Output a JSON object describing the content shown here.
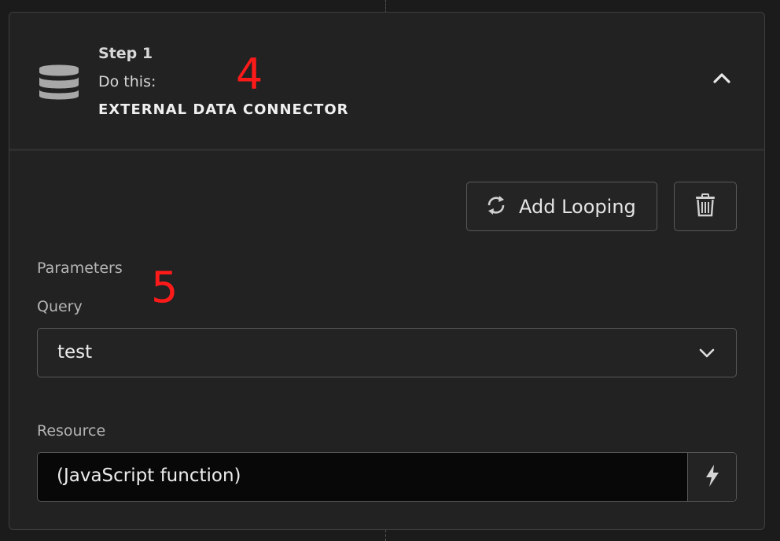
{
  "step": {
    "label": "Step 1",
    "action_prefix": "Do this:",
    "connector_name": "EXTERNAL DATA CONNECTOR",
    "icon": "database-icon"
  },
  "annotations": {
    "marker_header": "4",
    "marker_params": "5",
    "color": "#ff1a1a"
  },
  "toolbar": {
    "add_looping_label": "Add Looping",
    "add_looping_icon": "loop-icon",
    "delete_icon": "trash-icon"
  },
  "parameters": {
    "section_label": "Parameters",
    "query": {
      "label": "Query",
      "selected_value": "test"
    },
    "resource": {
      "label": "Resource",
      "value": "(JavaScript function)",
      "action_icon": "lightning-bolt-icon"
    }
  }
}
